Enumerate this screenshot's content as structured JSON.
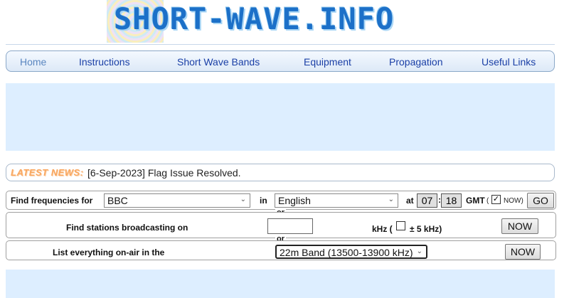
{
  "logo": {
    "text": "SHORT-WAVE.INFO"
  },
  "nav": {
    "items": [
      {
        "label": "Home"
      },
      {
        "label": "Instructions"
      },
      {
        "label": "Short Wave Bands"
      },
      {
        "label": "Equipment"
      },
      {
        "label": "Propagation"
      },
      {
        "label": "Useful Links"
      }
    ]
  },
  "news": {
    "label": "LATEST NEWS:",
    "text": "[6-Sep-2023] Flag Issue Resolved."
  },
  "find": {
    "label": "Find frequencies for",
    "station": "BBC",
    "in_label": "in",
    "language": "English",
    "at_label": "at",
    "hour": "07",
    "minute": "18",
    "gmt_label": "GMT",
    "paren_open": "(",
    "now_check": "✓",
    "now_label": "NOW)",
    "go": "GO"
  },
  "or1": "or",
  "broadcast": {
    "label": "Find stations broadcasting on",
    "khz_value": "",
    "khz_label": "kHz (",
    "tol_label": "± 5 kHz)",
    "now": "NOW"
  },
  "or2": "or",
  "onair": {
    "label": "List everything on-air in the",
    "band": "22m Band (13500-13900 kHz)",
    "now": "NOW"
  },
  "colors": {
    "nav_text": "#1a3fa6",
    "panel": "#ddeeff",
    "news_label": "#f9a760",
    "logo": "#1c70c8"
  }
}
